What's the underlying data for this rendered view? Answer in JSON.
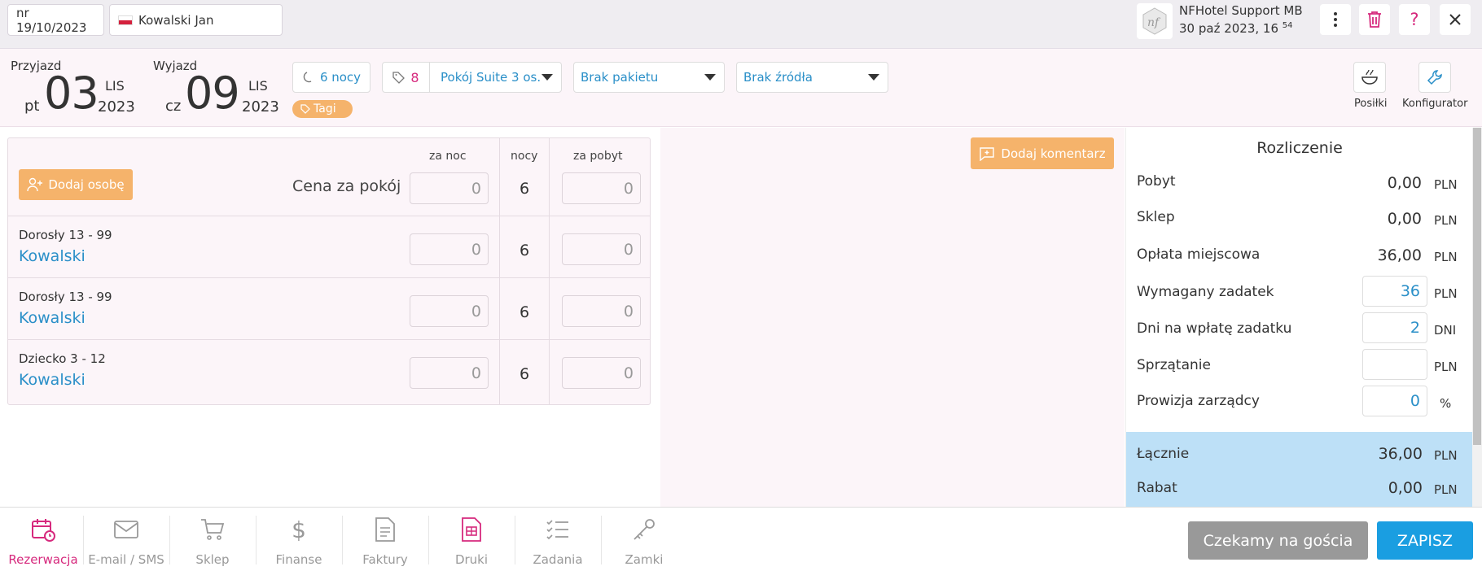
{
  "topbar": {
    "reservation_no": "nr 19/10/2023",
    "guest_name": "Kowalski Jan",
    "support_name": "NFHotel Support MB",
    "support_date": "30 paź 2023, 16",
    "support_time_sup": "54"
  },
  "header": {
    "arrival": {
      "label": "Przyjazd",
      "dow": "pt",
      "day": "03",
      "month": "LIS",
      "year": "2023"
    },
    "departure": {
      "label": "Wyjazd",
      "dow": "cz",
      "day": "09",
      "month": "LIS",
      "year": "2023"
    },
    "nights_label": "6 nocy",
    "tags_label": "Tagi",
    "room_number": "8",
    "room_type": "Pokój Suite 3 os.",
    "package": "Brak pakietu",
    "source": "Brak źródła",
    "meals_label": "Posiłki",
    "configurator_label": "Konfigurator"
  },
  "guests": {
    "add_person_label": "Dodaj osobę",
    "col_per_night": "za noc",
    "col_nights": "nocy",
    "col_per_stay": "za pobyt",
    "price_label": "Cena za pokój",
    "room_row": {
      "per_night": "0",
      "nights": "6",
      "per_stay": "0"
    },
    "rows": [
      {
        "type": "Dorosły 13 - 99",
        "name": "Kowalski",
        "per_night": "0",
        "nights": "6",
        "per_stay": "0"
      },
      {
        "type": "Dorosły 13 - 99",
        "name": "Kowalski",
        "per_night": "0",
        "nights": "6",
        "per_stay": "0"
      },
      {
        "type": "Dziecko 3 - 12",
        "name": "Kowalski",
        "per_night": "0",
        "nights": "6",
        "per_stay": "0"
      }
    ]
  },
  "comment_label": "Dodaj komentarz",
  "settlement": {
    "title": "Rozliczenie",
    "stay": {
      "label": "Pobyt",
      "value": "0,00",
      "cur": "PLN"
    },
    "shop": {
      "label": "Sklep",
      "value": "0,00",
      "cur": "PLN"
    },
    "local_fee": {
      "label": "Opłata miejscowa",
      "value": "36,00",
      "cur": "PLN"
    },
    "deposit": {
      "label": "Wymagany zadatek",
      "value": "36",
      "cur": "PLN"
    },
    "deposit_days": {
      "label": "Dni na wpłatę zadatku",
      "value": "2",
      "cur": "DNI"
    },
    "cleaning": {
      "label": "Sprzątanie",
      "value": "",
      "cur": "PLN"
    },
    "commission": {
      "label": "Prowizja zarządcy",
      "value": "0",
      "cur": "%"
    },
    "total": {
      "label": "Łącznie",
      "value": "36,00",
      "cur": "PLN"
    },
    "discount": {
      "label": "Rabat",
      "value": "0,00",
      "cur": "PLN"
    }
  },
  "nav": {
    "tabs": [
      {
        "label": "Rezerwacja",
        "icon": "calendar-clock-icon"
      },
      {
        "label": "E-mail / SMS",
        "icon": "envelope-icon"
      },
      {
        "label": "Sklep",
        "icon": "cart-icon"
      },
      {
        "label": "Finanse",
        "icon": "dollar-icon"
      },
      {
        "label": "Faktury",
        "icon": "invoice-icon"
      },
      {
        "label": "Druki",
        "icon": "print-form-icon"
      },
      {
        "label": "Zadania",
        "icon": "checklist-icon"
      },
      {
        "label": "Zamki",
        "icon": "key-icon"
      }
    ],
    "wait_label": "Czekamy na gościa",
    "save_label": "ZAPISZ"
  },
  "colors": {
    "accent_blue": "#2a8fc8",
    "accent_pink": "#d6297d",
    "orange": "#f5b36b",
    "save_blue": "#1a9ee1"
  }
}
